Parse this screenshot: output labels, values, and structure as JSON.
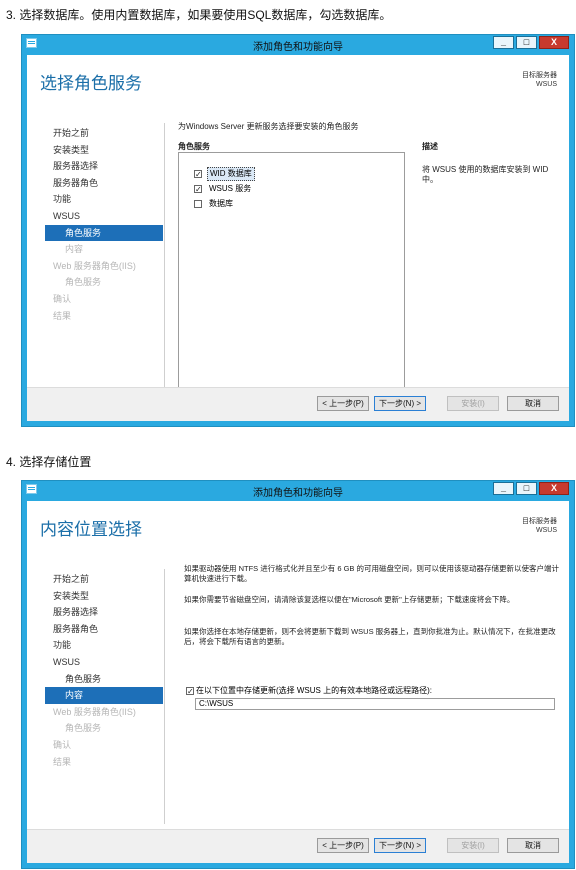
{
  "caption1": "3. 选择数据库。使用内置数据库，如果要使用SQL数据库，勾选数据库。",
  "caption2": "4. 选择存储位置",
  "window": {
    "title": "添加角色和功能向导",
    "minimize": "_",
    "maximize": "□",
    "close": "X",
    "dest_label": "目标服务器",
    "dest_server": "WSUS"
  },
  "nav": [
    {
      "label": "开始之前",
      "state": "normal",
      "sub": false
    },
    {
      "label": "安装类型",
      "state": "normal",
      "sub": false
    },
    {
      "label": "服务器选择",
      "state": "normal",
      "sub": false
    },
    {
      "label": "服务器角色",
      "state": "normal",
      "sub": false
    },
    {
      "label": "功能",
      "state": "normal",
      "sub": false
    },
    {
      "label": "WSUS",
      "state": "normal",
      "sub": false
    },
    {
      "label": "角色服务",
      "state": "normal",
      "sub": true
    },
    {
      "label": "内容",
      "state": "normal",
      "sub": true
    },
    {
      "label": "Web 服务器角色(IIS)",
      "state": "normal",
      "sub": false
    },
    {
      "label": "角色服务",
      "state": "normal",
      "sub": true
    },
    {
      "label": "确认",
      "state": "normal",
      "sub": false
    },
    {
      "label": "结果",
      "state": "disabled",
      "sub": false
    }
  ],
  "buttons": {
    "prev": "< 上一步(P)",
    "next": "下一步(N) >",
    "install": "安装(I)",
    "cancel": "取消"
  },
  "page1": {
    "title": "选择角色服务",
    "intro": "为Windows Server 更新服务选择要安装的角色服务",
    "col_roles": "角色服务",
    "col_desc": "描述",
    "services": [
      {
        "label": "WID 数据库",
        "checked": true
      },
      {
        "label": "WSUS 服务",
        "checked": true
      },
      {
        "label": "数据库",
        "checked": false
      }
    ],
    "description": "将 WSUS 使用的数据库安装到 WID 中。"
  },
  "page2": {
    "title": "内容位置选择",
    "para1": "如果驱动器使用 NTFS 进行格式化并且至少有 6 GB 的可用磁盘空间，则可以使用该驱动器存储更新以使客户端计算机快速进行下载。",
    "para2": "如果你需要节省磁盘空间，请清除该复选框以便在\"Microsoft 更新\"上存储更新；下载速度将会下降。",
    "para3": "如果你选择在本地存储更新，则不会将更新下载到 WSUS 服务器上，直到你批准为止。默认情况下，在批准更改后，将会下载所有语言的更新。",
    "store_label": "在以下位置中存储更新(选择 WSUS 上的有效本地路径或远程路径):",
    "store_checked": true,
    "path": "C:\\WSUS"
  }
}
